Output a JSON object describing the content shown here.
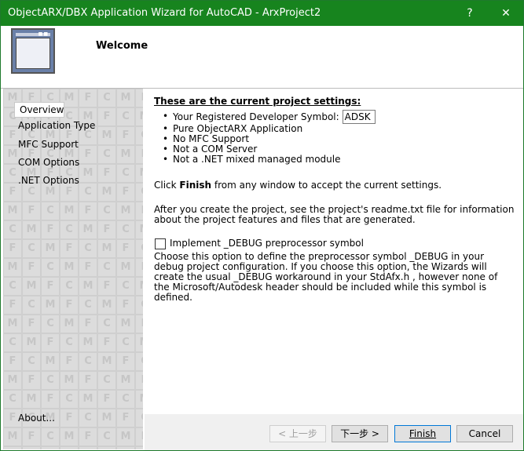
{
  "window": {
    "title": "ObjectARX/DBX Application Wizard for AutoCAD - ArxProject2"
  },
  "titlebar_buttons": {
    "help": "?",
    "close": "✕"
  },
  "header": {
    "title": "Welcome"
  },
  "sidebar": {
    "items": [
      {
        "label": "Overview"
      },
      {
        "label": "Application Type"
      },
      {
        "label": "MFC Support"
      },
      {
        "label": "COM Options"
      },
      {
        "label": ".NET Options"
      }
    ],
    "about": "About..."
  },
  "main": {
    "heading": "These are the current project settings:",
    "settings": {
      "symbol_label": "Your Registered Developer Symbol:",
      "symbol_value": "ADSK",
      "items": [
        "Pure ObjectARX Application",
        "No MFC Support",
        "Not a COM Server",
        "Not a .NET mixed managed module"
      ]
    },
    "finish_note": {
      "pre": "Click ",
      "bold": "Finish",
      "post": " from any window to accept the current settings."
    },
    "after_create": "After you create the project, see the project's readme.txt file for information about the project features and files that are generated.",
    "debug_checkbox_label": "Implement _DEBUG preprocessor symbol",
    "debug_description": "Choose this option to define the preprocessor symbol _DEBUG in your debug project configuration. If you choose this option, the Wizards will create the usual _DEBUG workaround in your StdAfx.h , however none of the Microsoft/Autodesk header should be included while this symbol is defined."
  },
  "footer": {
    "back": "< 上一步",
    "next": "下一步 >",
    "finish": "Finish",
    "cancel": "Cancel"
  }
}
